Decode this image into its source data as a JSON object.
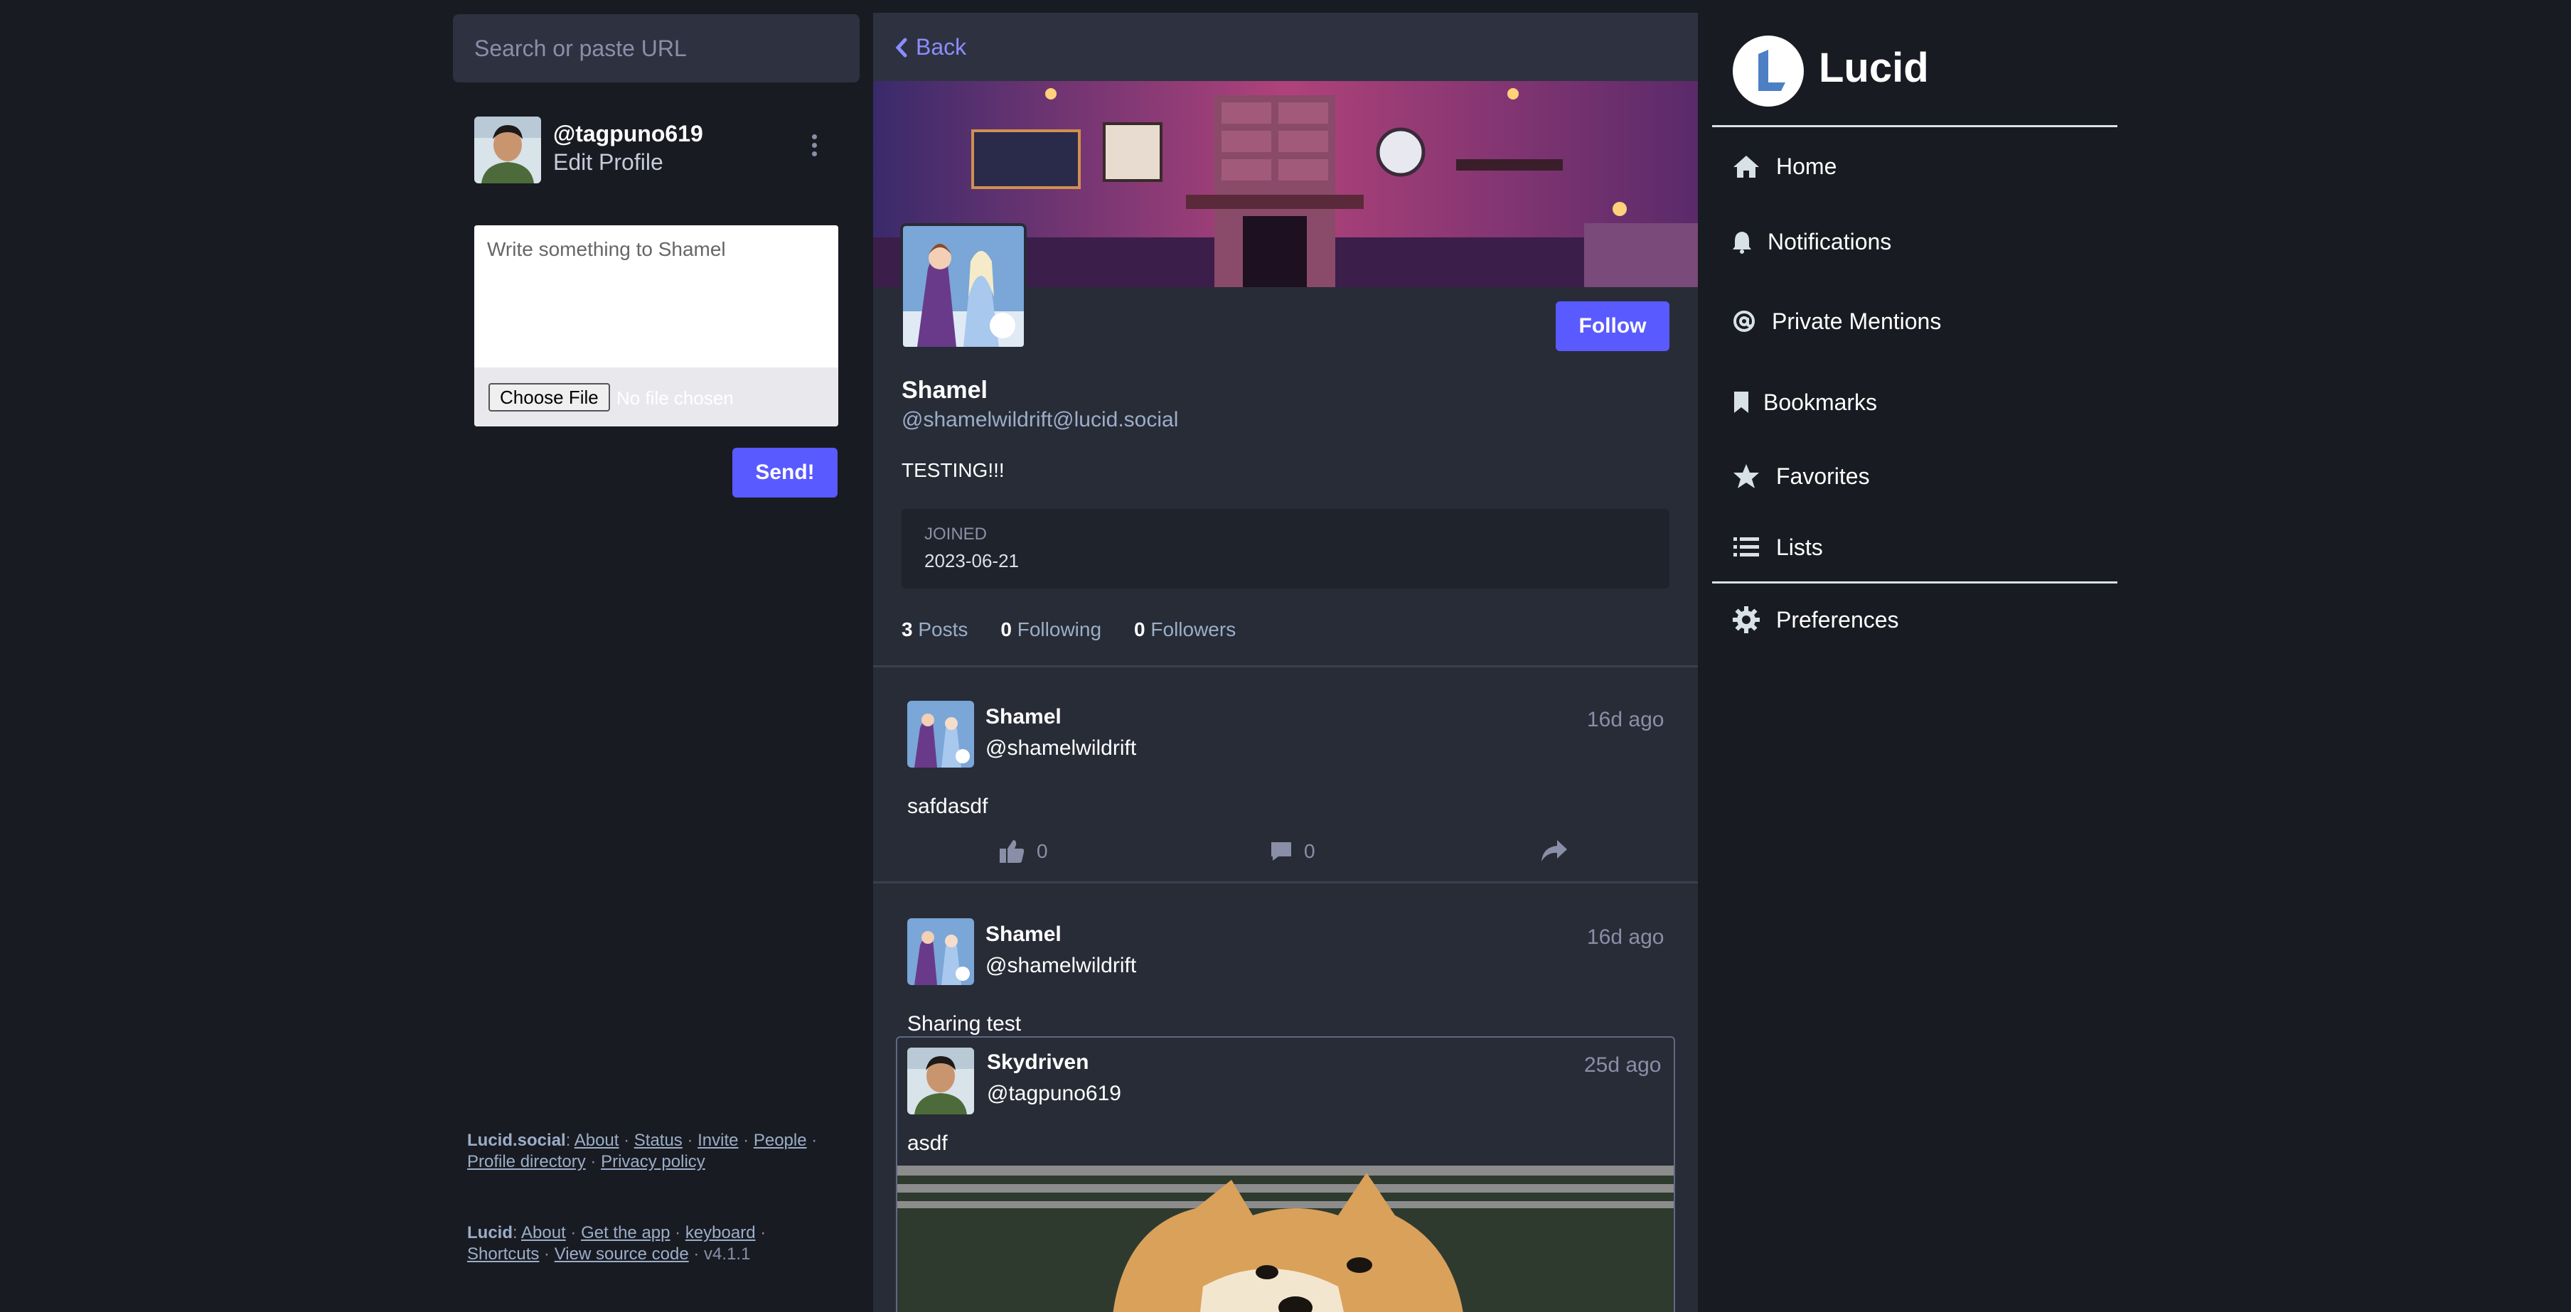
{
  "search": {
    "placeholder": "Search or paste URL"
  },
  "me": {
    "handle": "@tagpuno619",
    "edit_label": "Edit Profile"
  },
  "compose": {
    "placeholder": "Write something to Shamel",
    "choose_file": "Choose File",
    "no_file": "No file chosen",
    "send": "Send!"
  },
  "footer": {
    "site_name": "Lucid.social",
    "site_links": [
      "About",
      "Status",
      "Invite",
      "People",
      "Profile directory",
      "Privacy policy"
    ],
    "app_name": "Lucid",
    "app_links": [
      "About",
      "Get the app",
      "keyboard",
      "Shortcuts",
      "View source code"
    ],
    "version": "v4.1.1"
  },
  "profile": {
    "back": "Back",
    "follow": "Follow",
    "display_name": "Shamel",
    "account": "@shamelwildrift@lucid.social",
    "bio": "TESTING!!!",
    "joined_label": "JOINED",
    "joined_date": "2023-06-21",
    "stats": [
      {
        "count": "3",
        "label": "Posts"
      },
      {
        "count": "0",
        "label": "Following"
      },
      {
        "count": "0",
        "label": "Followers"
      }
    ]
  },
  "posts": [
    {
      "name": "Shamel",
      "handle": "@shamelwildrift",
      "time": "16d ago",
      "text": "safdasdf",
      "likes": "0",
      "replies": "0"
    },
    {
      "name": "Shamel",
      "handle": "@shamelwildrift",
      "time": "16d ago",
      "text": "Sharing test"
    }
  ],
  "quoted": {
    "name": "Skydriven",
    "handle": "@tagpuno619",
    "time": "25d ago",
    "text": "asdf"
  },
  "brand": {
    "name": "Lucid",
    "accent": "#595aff"
  },
  "nav": [
    {
      "label": "Home",
      "icon": "home-icon"
    },
    {
      "label": "Notifications",
      "icon": "bell-icon"
    },
    {
      "label": "Private Mentions",
      "icon": "at-icon"
    },
    {
      "label": "Bookmarks",
      "icon": "bookmark-icon"
    },
    {
      "label": "Favorites",
      "icon": "star-icon"
    },
    {
      "label": "Lists",
      "icon": "list-icon"
    },
    {
      "label": "Preferences",
      "icon": "gear-icon"
    }
  ]
}
